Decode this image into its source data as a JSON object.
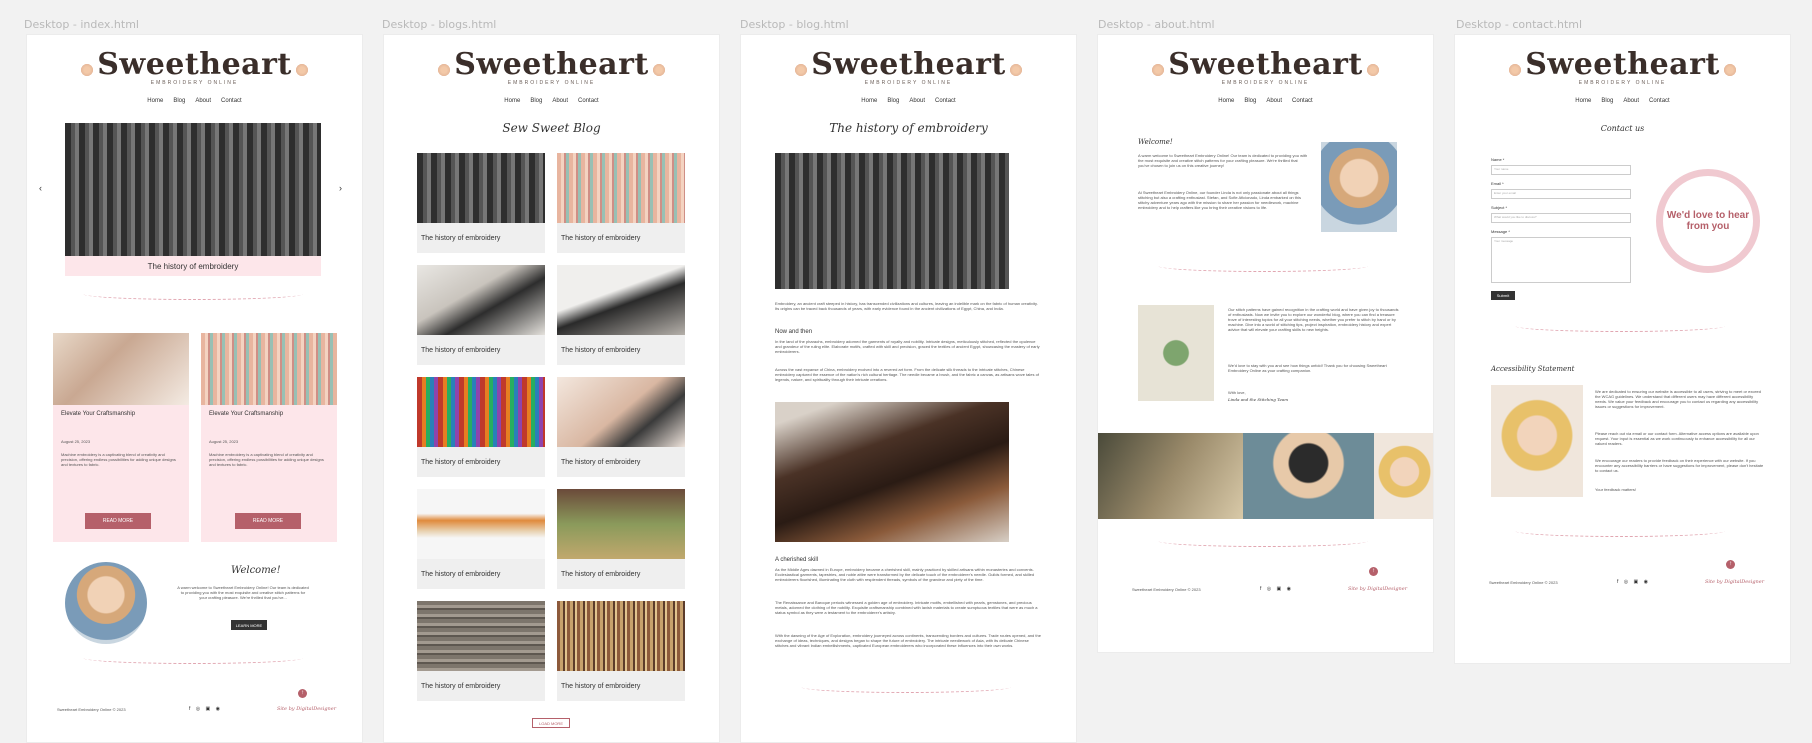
{
  "frames": [
    {
      "label": "Desktop  - index.html"
    },
    {
      "label": "Desktop  - blogs.html"
    },
    {
      "label": "Desktop  - blog.html"
    },
    {
      "label": "Desktop  - about.html"
    },
    {
      "label": "Desktop  - contact.html"
    }
  ],
  "brand": {
    "name": "Sweetheart",
    "tagline": "EMBROIDERY ONLINE"
  },
  "nav": [
    "Home",
    "Blog",
    "About",
    "Contact"
  ],
  "index": {
    "carousel_caption": "The history of embroidery",
    "cards": [
      {
        "title": "Elevate Your Craftsmanship",
        "date": "August 25, 2023",
        "text": "Machine embroidery is a captivating blend of creativity and precision, offering endless possibilities for adding unique designs and textures to fabric.",
        "button": "READ MORE"
      },
      {
        "title": "Elevate Your Craftsmanship",
        "date": "August 25, 2023",
        "text": "Machine embroidery is a captivating blend of creativity and precision, offering endless possibilities for adding unique designs and textures to fabric.",
        "button": "READ MORE"
      }
    ],
    "welcome_title": "Welcome!",
    "welcome_text": "A warm welcome to Sweetheart Embroidery Online! Our team is dedicated to providing you with the most exquisite and creative stitch patterns for your crafting pleasure. We're thrilled that you've...",
    "learn_more": "LEARN MORE"
  },
  "blogs": {
    "title": "Sew Sweet Blog",
    "card_caption": "The history of embroidery",
    "load_more": "LOAD MORE"
  },
  "blog": {
    "title": "The history of embroidery",
    "intro": "Embroidery, an ancient craft steeped in history, has transcended civilizations and cultures, leaving an indelible mark on the fabric of human creativity. Its origins can be traced back thousands of years, with early evidence found in the ancient civilizations of Egypt, China, and India.",
    "h1": "Now and then",
    "p1": "In the land of the pharaohs, embroidery adorned the garments of royalty and nobility. Intricate designs, meticulously stitched, reflected the opulence and grandeur of the ruling elite. Elaborate motifs, crafted with skill and precision, graced the textiles of ancient Egypt, showcasing the mastery of early embroiderers.",
    "p2": "Across the vast expanse of China, embroidery evolved into a revered art form. From the delicate silk threads to the intricate stitches, Chinese embroidery captured the essence of the nation's rich cultural heritage. The needle became a brush, and the fabric a canvas, as artisans wove tales of legends, nature, and spirituality through their intricate creations.",
    "h2": "A cherished skill",
    "p3": "As the Middle Ages dawned in Europe, embroidery became a cherished skill, mainly practiced by skilled artisans within monasteries and convents. Ecclesiastical garments, tapestries, and noble attire were transformed by the delicate touch of the embroiderer's needle. Guilds formed, and skilled embroiderers flourished, illuminating the cloth with resplendent threads, symbols of the grandeur and piety of the time.",
    "p4": "The Renaissance and Baroque periods witnessed a golden age of embroidery. Intricate motifs, embellished with pearls, gemstones, and precious metals, adorned the clothing of the nobility. Exquisite craftsmanship combined with lavish materials to create sumptuous textiles that were as much a status symbol as they were a testament to the embroiderer's artistry.",
    "p5": "With the dawning of the Age of Exploration, embroidery journeyed across continents, transcending borders and cultures. Trade routes opened, and the exchange of ideas, techniques, and designs began to shape the future of embroidery. The intricate needlework of Asia, with its delicate Chinese stitches and vibrant Indian embellishments, captivated European embroiderers who incorporated these influences into their own works."
  },
  "about": {
    "welcome_title": "Welcome!",
    "p1": "A warm welcome to Sweetheart Embroidery Online! Our team is dedicated to providing you with the most exquisite and creative stitch patterns for your crafting pleasure. We're thrilled that you've chosen to join us on this creative journey!",
    "p2": "At Sweetheart Embroidery Online, our founder Linda is not only passionate about all things stitching but also a crafting enthusiast. Stefan, and Sofie Aficionado, Linda embarked on this stitchy adventure years ago with the mission to share her passion for needlework, machine embroidery and to help crafters like you bring their creative visions to life.",
    "p3": "Our stitch patterns have gained recognition in the crafting world and have given joy to thousands of enthusiasts. Now we invite you to explore our wonderful blog, where you can find a treasure trove of interesting topics for all your stitching needs, whether you prefer to stitch by hand or by machine. Dive into a world of stitching tips, project inspiration, embroidery history and expert advice that will elevate your crafting skills to new heights.",
    "p4": "We'd love to stay with you and see how things unfold! Thank you for choosing Sweetheart Embroidery Online as your crafting companion.",
    "sign": "With love,",
    "sign_names": "Linda and the Stitching Team"
  },
  "contact": {
    "title": "Contact us",
    "name_label": "Name *",
    "name_ph": "Your name",
    "email_label": "Email *",
    "email_ph": "Enter your email",
    "subject_label": "Subject *",
    "subject_ph": "What would you like to discuss?",
    "message_label": "Message *",
    "message_ph": "Your message",
    "submit": "Submit",
    "wreath": "We'd love to hear from you",
    "access_title": "Accessibility Statement",
    "a1": "We are dedicated to ensuring our website is accessible to all users, striving to meet or exceed the WCAG guidelines. We understand that different users may have different accessibility needs. We value your feedback and encourage you to contact us regarding any accessibility issues or suggestions for improvement.",
    "a2": "Please reach out via email or our contact form. Alternative access options are available upon request. Your input is essential as we work continuously to enhance accessibility for all our valued readers.",
    "a3": "We encourage our readers to provide feedback on their experience with our website. If you encounter any accessibility barriers or have suggestions for improvement, please don't hesitate to contact us.",
    "a4": "Your feedback matters!"
  },
  "footer": {
    "copyright": "Sweetheart Embroidery Online ©  2023",
    "credit": "Site by DigitalDesigner",
    "social": "f ◎ ▣ ◉"
  }
}
